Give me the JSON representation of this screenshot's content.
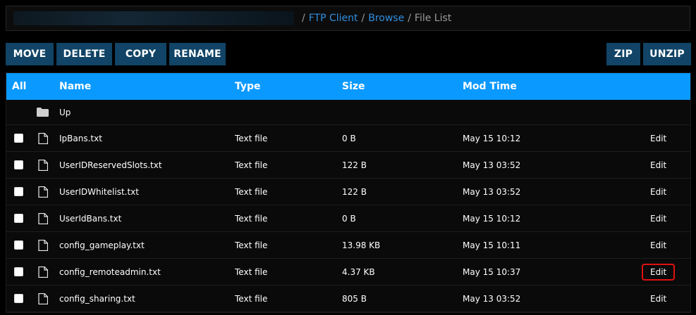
{
  "breadcrumb": {
    "items": [
      "FTP Client",
      "Browse"
    ],
    "separator": "/",
    "current": "File List"
  },
  "toolbar": {
    "move_label": "MOVE",
    "delete_label": "DELETE",
    "copy_label": "COPY",
    "rename_label": "RENAME",
    "zip_label": "ZIP",
    "unzip_label": "UNZIP"
  },
  "table": {
    "headers": {
      "all": "All",
      "name": "Name",
      "type": "Type",
      "size": "Size",
      "mod_time": "Mod Time"
    },
    "up_label": "Up",
    "edit_label": "Edit",
    "rows": [
      {
        "name": "IpBans.txt",
        "type": "Text file",
        "size": "0 B",
        "mod_time": "May 15 10:12"
      },
      {
        "name": "UserIDReservedSlots.txt",
        "type": "Text file",
        "size": "122 B",
        "mod_time": "May 13 03:52"
      },
      {
        "name": "UserIDWhitelist.txt",
        "type": "Text file",
        "size": "122 B",
        "mod_time": "May 13 03:52"
      },
      {
        "name": "UserIdBans.txt",
        "type": "Text file",
        "size": "0 B",
        "mod_time": "May 15 10:12"
      },
      {
        "name": "config_gameplay.txt",
        "type": "Text file",
        "size": "13.98 KB",
        "mod_time": "May 15 10:11"
      },
      {
        "name": "config_remoteadmin.txt",
        "type": "Text file",
        "size": "4.37 KB",
        "mod_time": "May 15 10:37"
      },
      {
        "name": "config_sharing.txt",
        "type": "Text file",
        "size": "805 B",
        "mod_time": "May 13 03:52"
      }
    ]
  },
  "colors": {
    "header_bg": "#0a99ff",
    "button_bg": "#114466",
    "link": "#2f8fe0",
    "highlight": "#e01010"
  }
}
